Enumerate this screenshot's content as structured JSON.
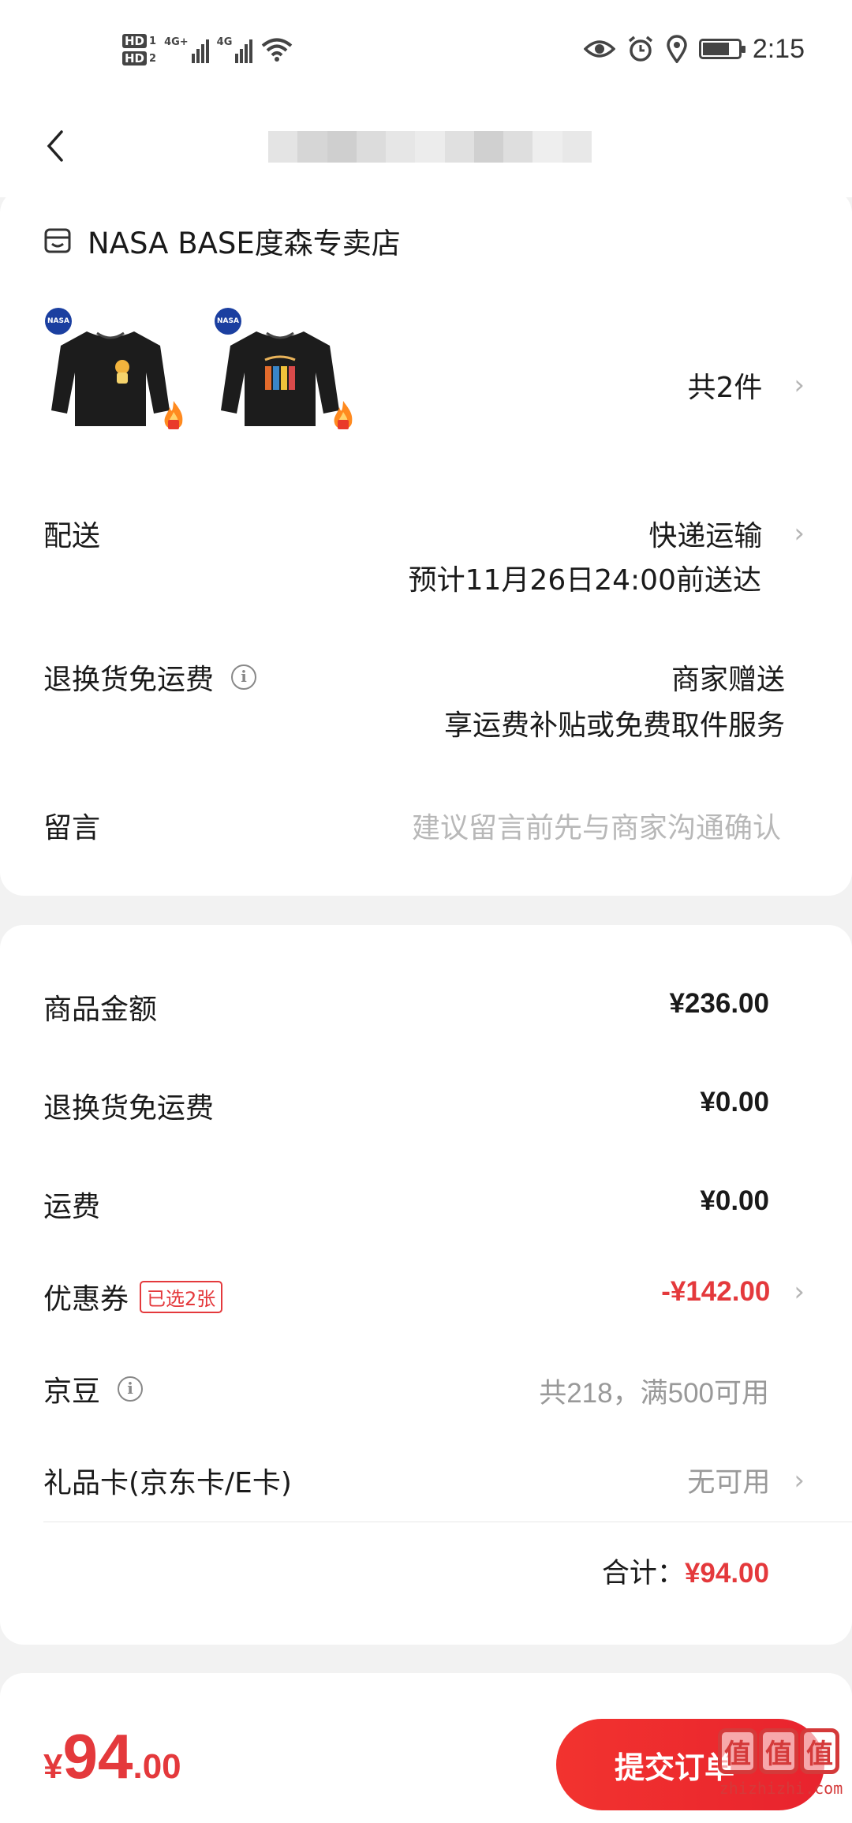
{
  "status_bar": {
    "hd1": "HD",
    "hd1_num": "1",
    "hd2": "HD",
    "hd2_num": "2",
    "net1": "4G+",
    "net2": "4G",
    "time": "2:15"
  },
  "shop": {
    "name": "NASA BASE度森专卖店"
  },
  "products": {
    "badge": "NASA",
    "count_label": "共2件"
  },
  "delivery": {
    "label": "配送",
    "method": "快递运输",
    "eta": "预计11月26日24:00前送达"
  },
  "return_shipping": {
    "label": "退换货免运费",
    "provider": "商家赠送",
    "desc": "享运费补贴或免费取件服务"
  },
  "message": {
    "label": "留言",
    "placeholder": "建议留言前先与商家沟通确认"
  },
  "pricing": {
    "goods_label": "商品金额",
    "goods_value": "¥236.00",
    "return_label": "退换货免运费",
    "return_value": "¥0.00",
    "shipping_label": "运费",
    "shipping_value": "¥0.00",
    "coupon_label": "优惠券",
    "coupon_badge": "已选2张",
    "coupon_value": "-¥142.00",
    "jd_beans_label": "京豆",
    "jd_beans_value": "共218，满500可用",
    "giftcard_label": "礼品卡(京东卡/E卡)",
    "giftcard_value": "无可用",
    "total_label": "合计：",
    "total_value": "¥94.00"
  },
  "footer": {
    "price_symbol": "¥",
    "price_int": "94",
    "price_dec": ".00",
    "submit_label": "提交订单"
  },
  "watermark": {
    "logo_char": "值",
    "url": "zhizhizhi.com"
  },
  "colors": {
    "accent": "#e4393c",
    "background": "#f2f2f2"
  }
}
